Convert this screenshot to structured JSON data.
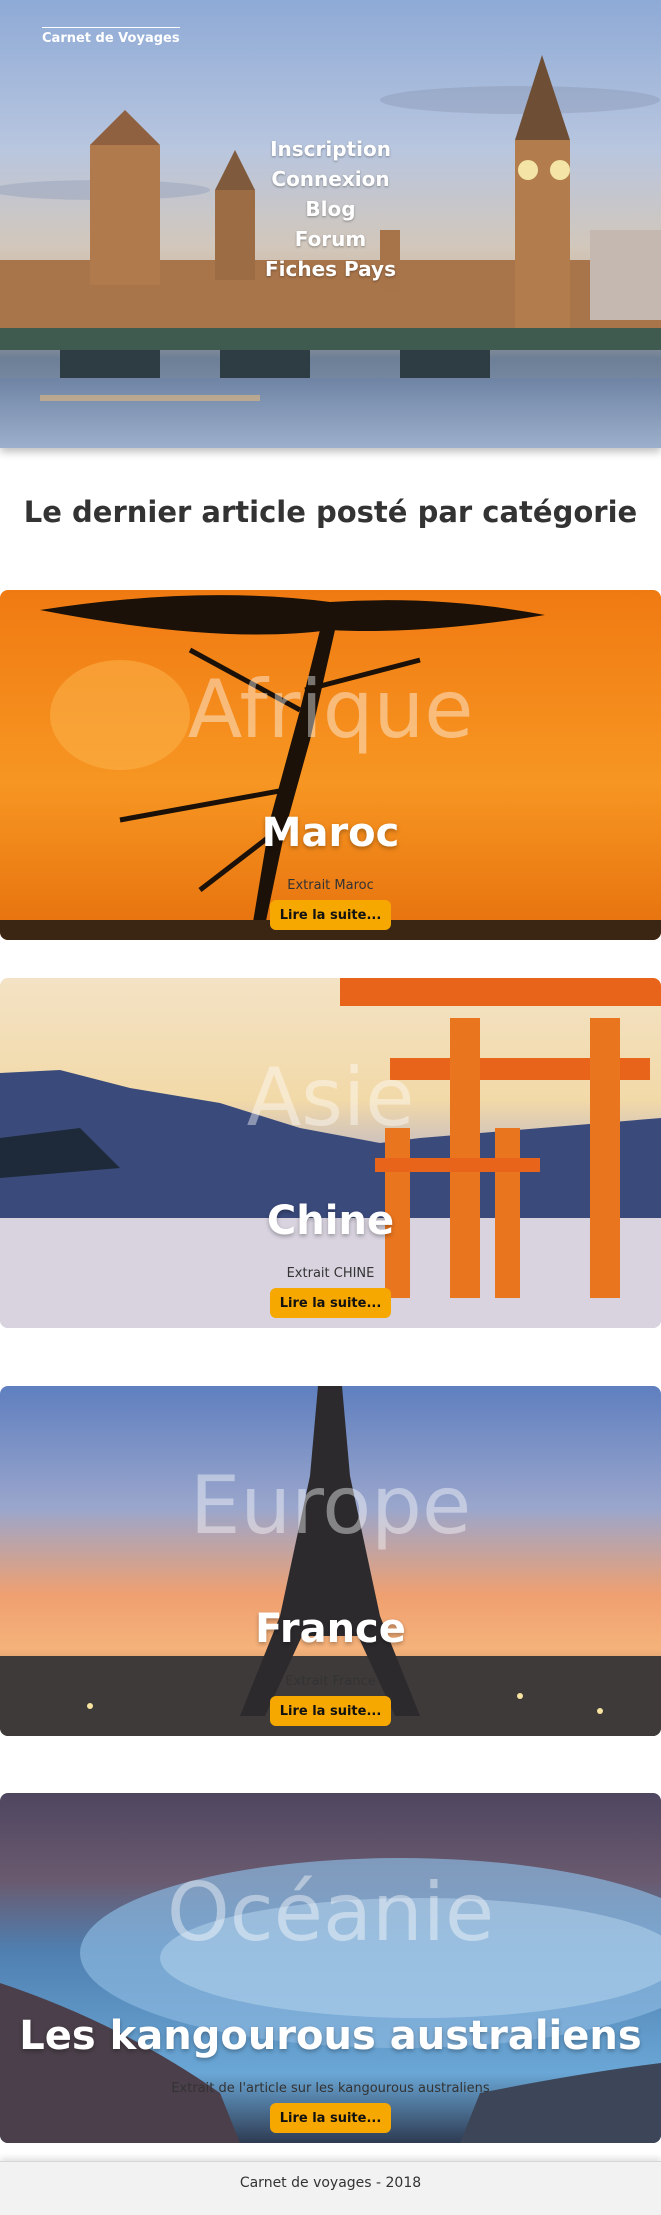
{
  "header": {
    "brand": "Carnet de Voyages",
    "nav": [
      "Inscription",
      "Connexion",
      "Blog",
      "Forum",
      "Fiches Pays"
    ]
  },
  "main": {
    "title": "Le dernier article posté par catégorie",
    "cards": [
      {
        "category": "Afrique",
        "article_title": "Maroc",
        "excerpt": "Extrait Maroc",
        "button": "Lire la suite..."
      },
      {
        "category": "Asie",
        "article_title": "Chine",
        "excerpt": "Extrait CHINE",
        "button": "Lire la suite..."
      },
      {
        "category": "Europe",
        "article_title": "France",
        "excerpt": "Extrait France",
        "button": "Lire la suite..."
      },
      {
        "category": "Océanie",
        "article_title": "Les kangourous australiens",
        "excerpt": "Extrait de l'article sur les kangourous australiens",
        "button": "Lire la suite..."
      }
    ]
  },
  "footer": {
    "text": "Carnet de voyages - 2018"
  },
  "colors": {
    "button": "#f6a800",
    "title_text": "#333333",
    "footer_bg": "#f2f2f2"
  }
}
